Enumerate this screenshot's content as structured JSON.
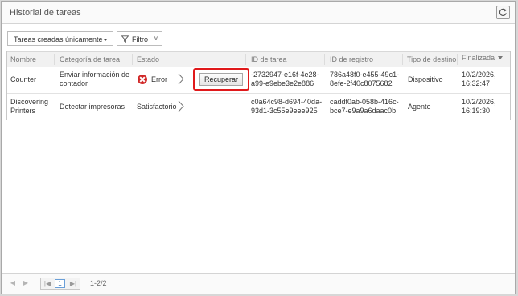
{
  "window": {
    "title": "Historial de tareas",
    "refresh_icon": "refresh-icon"
  },
  "toolbar": {
    "dropdown_value": "Tareas creadas únicamente",
    "filter_label": "Filtro"
  },
  "table": {
    "headers": [
      "Nombre",
      "Categoría de tarea",
      "Estado",
      "ID de tarea",
      "ID de registro",
      "Tipo de destino",
      "Finalizada"
    ],
    "sort_column": "Finalizada",
    "rows": [
      {
        "name": "Counter",
        "category": [
          "Enviar información de",
          "contador"
        ],
        "status": "Error",
        "status_icon": "error-icon",
        "action": "Recuperar",
        "task_id": [
          "-2732947-e16f-4e28-",
          "a99-e9ebe3e2e886"
        ],
        "record_id": [
          "786a48f0-e455-49c1-",
          "8efe-2f40c8075682"
        ],
        "target_type": "Dispositivo",
        "finished": [
          "10/2/2026,",
          "16:32:47"
        ]
      },
      {
        "name": [
          "Discovering",
          "Printers"
        ],
        "category": "Detectar impresoras",
        "status": "Satisfactorio",
        "task_id": [
          "c0a64c98-d694-40da-",
          "93d1-3c55e9eee925"
        ],
        "record_id": [
          "caddf0ab-058b-416c-",
          "bce7-e9a9a6daac0b"
        ],
        "target_type": "Agente",
        "finished": [
          "10/2/2026,",
          "16:19:30"
        ]
      }
    ]
  },
  "pagination": {
    "current_page": "1",
    "info": "1-2/2"
  },
  "colors": {
    "highlight": "#e0191b",
    "error": "#d02626",
    "accent": "#3f86d9"
  }
}
